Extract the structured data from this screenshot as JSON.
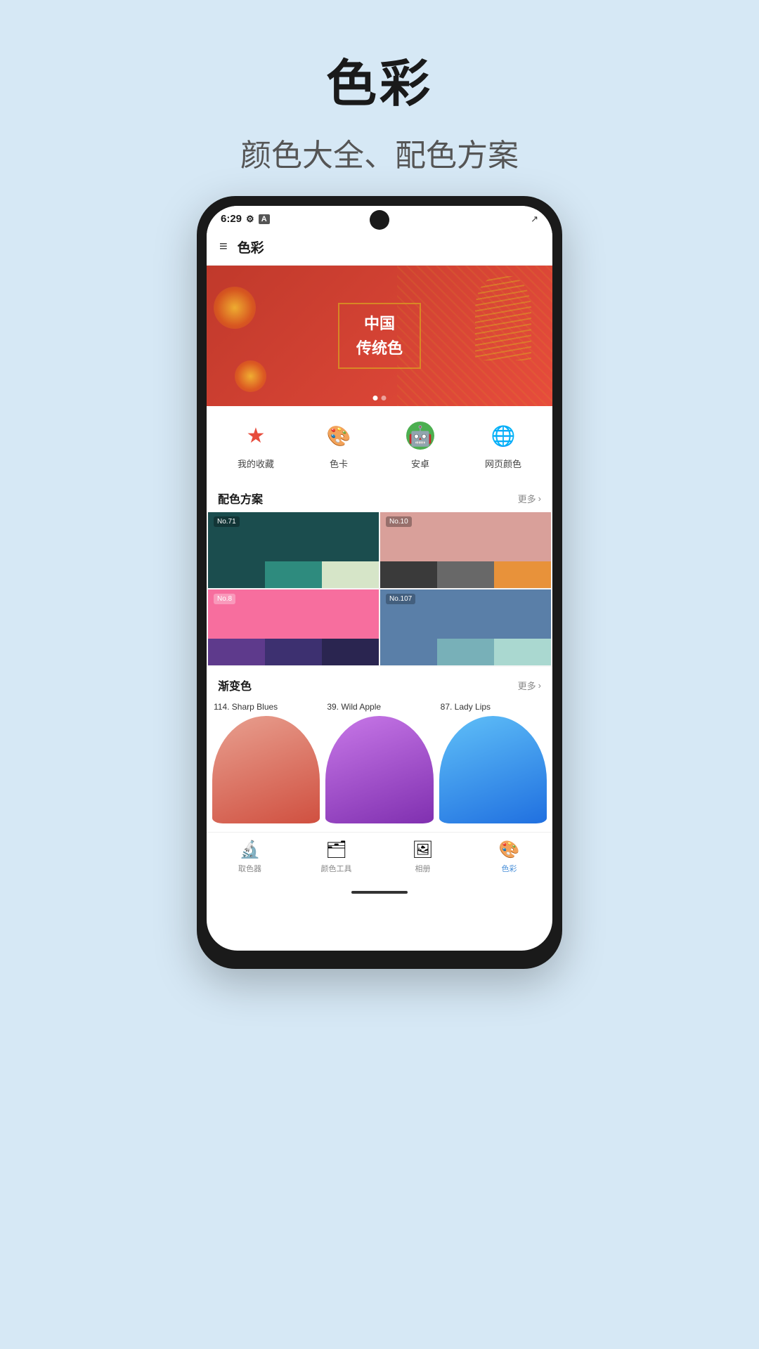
{
  "page": {
    "title": "色彩",
    "subtitle": "颜色大全、配色方案"
  },
  "status_bar": {
    "time": "6:29",
    "signal": "▲"
  },
  "app_bar": {
    "title": "色彩",
    "menu_icon": "≡"
  },
  "banner": {
    "line1": "中国",
    "line2": "传统色"
  },
  "quick_actions": [
    {
      "id": "favorites",
      "label": "我的收藏",
      "icon": "⭐",
      "color": "#e74c3c"
    },
    {
      "id": "color_card",
      "label": "色卡",
      "icon": "🎨",
      "color": "#3498db"
    },
    {
      "id": "android",
      "label": "安卓",
      "icon": "🤖",
      "color": "#2ecc71"
    },
    {
      "id": "web_color",
      "label": "网页颜色",
      "icon": "🌐",
      "color": "#3498db"
    }
  ],
  "palette_section": {
    "title": "配色方案",
    "more": "更多",
    "palettes": [
      {
        "id": "no71",
        "number": "No.71",
        "top_color": "#1b4d4e",
        "swatches": [
          "#1b4d4e",
          "#2e8b7e",
          "#d6e5c8"
        ]
      },
      {
        "id": "no10",
        "number": "No.10",
        "top_color": "#d9a09a",
        "swatches": [
          "#3a3a3a",
          "#686868",
          "#e8923a"
        ]
      },
      {
        "id": "no8",
        "number": "No.8",
        "top_color": "#f76e9e",
        "swatches": [
          "#5e3a8c",
          "#3d3070",
          "#2a2550"
        ]
      },
      {
        "id": "no107",
        "number": "No.107",
        "top_color": "#5a7fa8",
        "swatches": [
          "#5a7fa8",
          "#78b0b8",
          "#aad8d0"
        ]
      }
    ]
  },
  "gradient_section": {
    "title": "渐变色",
    "more": "更多",
    "items": [
      {
        "id": "sharp_blues",
        "label": "114. Sharp Blues",
        "gradient_start": "#e8a090",
        "gradient_end": "#e06050"
      },
      {
        "id": "wild_apple",
        "label": "39. Wild Apple",
        "gradient_start": "#c060e0",
        "gradient_end": "#9040c0"
      },
      {
        "id": "lady_lips",
        "label": "87. Lady Lips",
        "gradient_start": "#4ab0f0",
        "gradient_end": "#2080e0"
      }
    ]
  },
  "bottom_nav": [
    {
      "id": "color_picker",
      "label": "取色器",
      "icon": "🔬",
      "active": false
    },
    {
      "id": "color_tool",
      "label": "颜色工具",
      "icon": "🗂",
      "active": false
    },
    {
      "id": "album",
      "label": "相册",
      "icon": "🖼",
      "active": false
    },
    {
      "id": "color_app",
      "label": "色彩",
      "icon": "🎨",
      "active": true
    }
  ]
}
